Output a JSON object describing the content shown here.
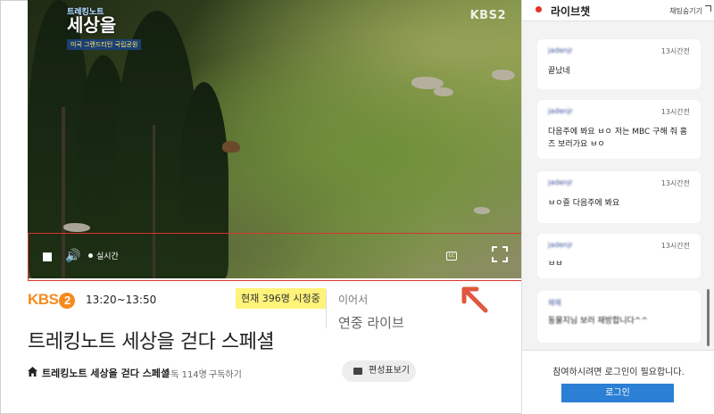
{
  "video": {
    "show_logo_top": "트레킹노트",
    "show_logo_main": "세상을",
    "show_logo_sub": "미국 그랜드티턴 국립공원",
    "watermark": "KBS2",
    "controls": {
      "live_label": "실시간",
      "cc_label": "CC"
    }
  },
  "program": {
    "channel_logo_text": "KBS",
    "channel_logo_num": "2",
    "time_range": "13:20~13:50",
    "viewer_badge": "현재 396명 시청중",
    "next_label": "이어서",
    "next_title": "연중 라이브",
    "title": "트레킹노트 세상을 걷다 스페셜",
    "program_name": "트레킹노트 세상을 걷다 스페셜",
    "subscriber_count": "구독 114명",
    "subscribe_button": "구독하기",
    "schedule_button": "편성표보기"
  },
  "chat": {
    "title": "라이브챗",
    "hide_label": "채팅숨기기",
    "messages": [
      {
        "user": "jadenjr",
        "ago": "13시간전",
        "text": "끝났네"
      },
      {
        "user": "jadenjr",
        "ago": "13시간전",
        "text": "다음주에 봐요 ㅂㅇ 저는 MBC 구해 줘 홈즈 보러가요 ㅂㅇ"
      },
      {
        "user": "jadenjr",
        "ago": "13시간전",
        "text": "ㅂㅇ즐 다음주에 봐요"
      },
      {
        "user": "jadenjr",
        "ago": "13시간전",
        "text": "ㅂㅂ"
      },
      {
        "user": "채채",
        "ago": "",
        "text": "동물지님 보러 재방합니다^^"
      }
    ],
    "login_prompt": "참여하시려면 로그인이 필요합니다.",
    "login_button": "로그인"
  },
  "colors": {
    "accent_red": "#d9342b",
    "kbs_orange": "#f58a1f",
    "badge_yellow": "#fff37a",
    "login_blue": "#2b7fd4"
  }
}
